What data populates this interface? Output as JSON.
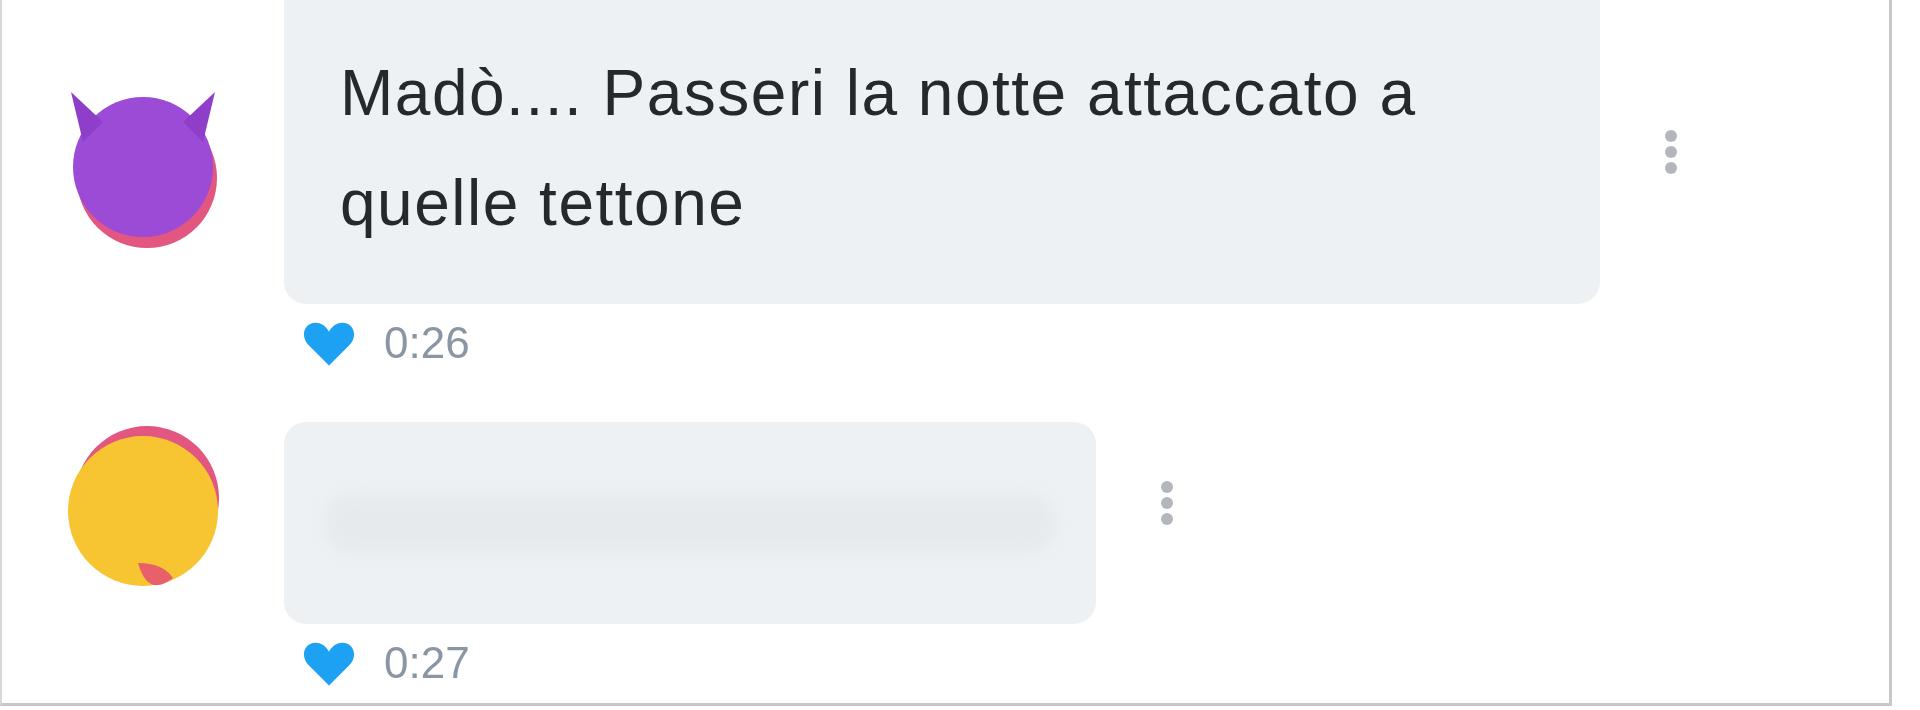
{
  "messages": [
    {
      "kind": "devil",
      "text": "Madò.... Passeri la notte attaccato a quelle tettone",
      "blurred": false,
      "liked": true,
      "time": "0:26"
    },
    {
      "kind": "smile",
      "blurred": true,
      "liked": true,
      "time": "0:27"
    }
  ]
}
